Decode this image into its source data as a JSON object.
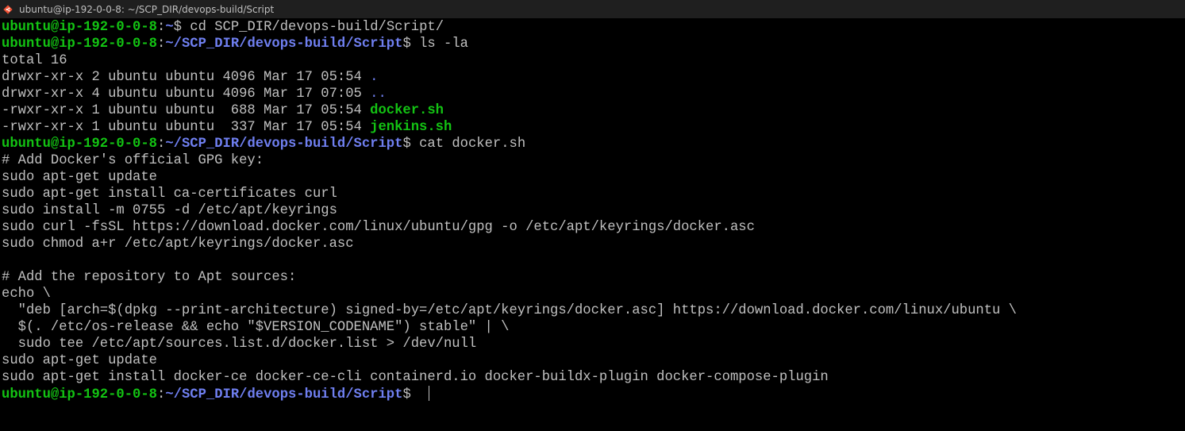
{
  "window": {
    "title": "ubuntu@ip-192-0-0-8: ~/SCP_DIR/devops-build/Script",
    "icon": "git-bash-icon"
  },
  "colors": {
    "background": "#000000",
    "text": "#c0c0c0",
    "prompt_user": "#13c313",
    "prompt_path": "#6f7ff0"
  },
  "terminal": {
    "cursor_visible": true,
    "lines": [
      {
        "type": "prompt",
        "user": "ubuntu@ip-192-0-0-8",
        "path": "~",
        "command": "cd SCP_DIR/devops-build/Script/"
      },
      {
        "type": "prompt",
        "user": "ubuntu@ip-192-0-0-8",
        "path": "~/SCP_DIR/devops-build/Script",
        "command": "ls -la"
      },
      {
        "type": "output",
        "text": "total 16"
      },
      {
        "type": "ls",
        "meta": "drwxr-xr-x 2 ubuntu ubuntu 4096 Mar 17 05:54 ",
        "name": ".",
        "kind": "dir"
      },
      {
        "type": "ls",
        "meta": "drwxr-xr-x 4 ubuntu ubuntu 4096 Mar 17 07:05 ",
        "name": "..",
        "kind": "dir"
      },
      {
        "type": "ls",
        "meta": "-rwxr-xr-x 1 ubuntu ubuntu  688 Mar 17 05:54 ",
        "name": "docker.sh",
        "kind": "exe"
      },
      {
        "type": "ls",
        "meta": "-rwxr-xr-x 1 ubuntu ubuntu  337 Mar 17 05:54 ",
        "name": "jenkins.sh",
        "kind": "exe"
      },
      {
        "type": "prompt",
        "user": "ubuntu@ip-192-0-0-8",
        "path": "~/SCP_DIR/devops-build/Script",
        "command": "cat docker.sh"
      },
      {
        "type": "output",
        "text": "# Add Docker's official GPG key:"
      },
      {
        "type": "output",
        "text": "sudo apt-get update"
      },
      {
        "type": "output",
        "text": "sudo apt-get install ca-certificates curl"
      },
      {
        "type": "output",
        "text": "sudo install -m 0755 -d /etc/apt/keyrings"
      },
      {
        "type": "output",
        "text": "sudo curl -fsSL https://download.docker.com/linux/ubuntu/gpg -o /etc/apt/keyrings/docker.asc"
      },
      {
        "type": "output",
        "text": "sudo chmod a+r /etc/apt/keyrings/docker.asc"
      },
      {
        "type": "output",
        "text": ""
      },
      {
        "type": "output",
        "text": "# Add the repository to Apt sources:"
      },
      {
        "type": "output",
        "text": "echo \\"
      },
      {
        "type": "output",
        "text": "  \"deb [arch=$(dpkg --print-architecture) signed-by=/etc/apt/keyrings/docker.asc] https://download.docker.com/linux/ubuntu \\"
      },
      {
        "type": "output",
        "text": "  $(. /etc/os-release && echo \"$VERSION_CODENAME\") stable\" | \\"
      },
      {
        "type": "output",
        "text": "  sudo tee /etc/apt/sources.list.d/docker.list > /dev/null"
      },
      {
        "type": "output",
        "text": "sudo apt-get update"
      },
      {
        "type": "output",
        "text": "sudo apt-get install docker-ce docker-ce-cli containerd.io docker-buildx-plugin docker-compose-plugin"
      },
      {
        "type": "prompt",
        "user": "ubuntu@ip-192-0-0-8",
        "path": "~/SCP_DIR/devops-build/Script",
        "command": "",
        "cursor": true
      }
    ]
  }
}
